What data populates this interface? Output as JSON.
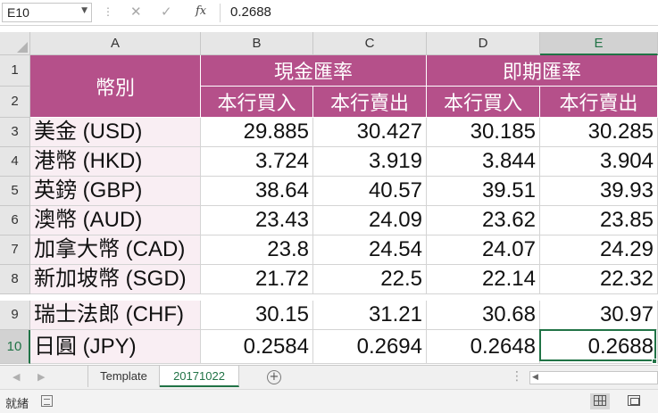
{
  "formula_bar": {
    "name_box": "E10",
    "fx_label": "fx",
    "formula_value": "0.2688"
  },
  "columns": [
    "A",
    "B",
    "C",
    "D",
    "E"
  ],
  "rows": [
    "1",
    "2",
    "3",
    "4",
    "5",
    "6",
    "7",
    "8",
    "9",
    "10"
  ],
  "selected": {
    "column": "E",
    "row": "10"
  },
  "table": {
    "header_currency": "幣別",
    "group_cash": "現金匯率",
    "group_spot": "即期匯率",
    "buy": "本行買入",
    "sell": "本行賣出",
    "data": [
      {
        "currency": "美金 (USD)",
        "cash_buy": "29.885",
        "cash_sell": "30.427",
        "spot_buy": "30.185",
        "spot_sell": "30.285"
      },
      {
        "currency": "港幣 (HKD)",
        "cash_buy": "3.724",
        "cash_sell": "3.919",
        "spot_buy": "3.844",
        "spot_sell": "3.904"
      },
      {
        "currency": "英鎊 (GBP)",
        "cash_buy": "38.64",
        "cash_sell": "40.57",
        "spot_buy": "39.51",
        "spot_sell": "39.93"
      },
      {
        "currency": "澳幣 (AUD)",
        "cash_buy": "23.43",
        "cash_sell": "24.09",
        "spot_buy": "23.62",
        "spot_sell": "23.85"
      },
      {
        "currency": "加拿大幣 (CAD)",
        "cash_buy": "23.8",
        "cash_sell": "24.54",
        "spot_buy": "24.07",
        "spot_sell": "24.29"
      },
      {
        "currency": "新加坡幣 (SGD)",
        "cash_buy": "21.72",
        "cash_sell": "22.5",
        "spot_buy": "22.14",
        "spot_sell": "22.32"
      },
      {
        "currency": "瑞士法郎 (CHF)",
        "cash_buy": "30.15",
        "cash_sell": "31.21",
        "spot_buy": "30.68",
        "spot_sell": "30.97"
      },
      {
        "currency": "日圓 (JPY)",
        "cash_buy": "0.2584",
        "cash_sell": "0.2694",
        "spot_buy": "0.2648",
        "spot_sell": "0.2688"
      }
    ]
  },
  "sheet_tabs": [
    "Template",
    "20171022"
  ],
  "active_tab": "20171022",
  "status": {
    "ready": "就緒"
  },
  "colors": {
    "header_fill": "#b5508a",
    "accent": "#217346",
    "row_tint": "#f9eef3"
  }
}
